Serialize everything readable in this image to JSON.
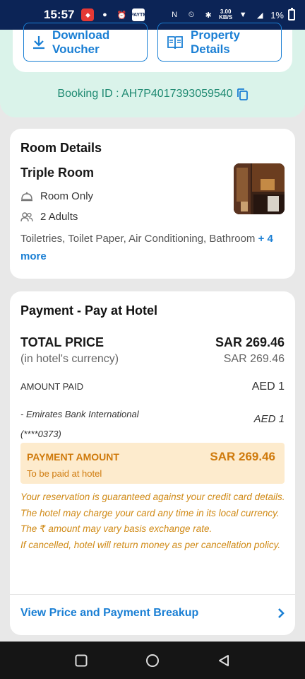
{
  "status": {
    "time": "15:57",
    "net_speed_top": "3.00",
    "net_speed_bottom": "KB/S",
    "battery": "1%",
    "notif_icons": [
      "news-icon",
      "chat-icon",
      "alarm-icon",
      "paytm-icon"
    ],
    "notif_paytm": "PAYTM"
  },
  "actions": {
    "download": "Download Voucher",
    "property": "Property Details"
  },
  "booking": {
    "text": "Booking ID : AH7P4017393059540"
  },
  "room": {
    "section_title": "Room Details",
    "room_type": "Triple Room",
    "meal": "Room Only",
    "occupancy": "2 Adults",
    "amenities": "Toiletries, Toilet Paper, Air Conditioning, Bathroom",
    "more": "+ 4 more"
  },
  "payment": {
    "section_title": "Payment - Pay at Hotel",
    "total_label": "TOTAL PRICE",
    "total_value": "SAR 269.46",
    "currency_label": "(in hotel's currency)",
    "currency_value": "SAR 269.46",
    "paid_label": "AMOUNT PAID",
    "paid_value": "AED 1",
    "bank_name": "- Emirates Bank International",
    "bank_card": "(****0373)",
    "bank_amount": "AED 1",
    "payment_amount_label": "PAYMENT AMOUNT",
    "payment_amount_value": "SAR 269.46",
    "payment_amount_sub": "To be paid at hotel",
    "notes": [
      "Your reservation is guaranteed against your credit card details.",
      "The hotel may charge your card any time in its local currency. The ₹ amount may vary basis exchange rate.",
      "If cancelled, hotel will return money as per cancellation policy."
    ],
    "breakup_link": "View Price and Payment Breakup"
  },
  "colors": {
    "accent": "#1a7fd4",
    "booking_green": "#1f8a72",
    "mint_bg": "#daf3ea",
    "warn": "#cf7a0c",
    "status_bar": "#0c2456"
  }
}
